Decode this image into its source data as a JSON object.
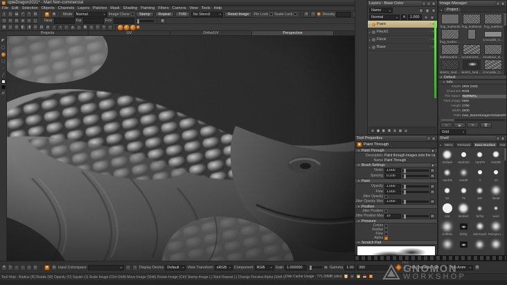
{
  "window": {
    "title": "opieDragon2021* - Mari Non-commercial"
  },
  "menubar": {
    "items": [
      "File",
      "Edit",
      "Selection",
      "Objects",
      "Channels",
      "Layers",
      "Patches",
      "Mask",
      "Shading",
      "Painting",
      "Filters",
      "Camera",
      "View",
      "Tools",
      "Help"
    ]
  },
  "toolbar": {
    "file_icons": [
      {
        "name": "new-project-icon",
        "glyph": "▯"
      },
      {
        "name": "open-project-icon",
        "glyph": "◱"
      },
      {
        "name": "save-project-icon",
        "glyph": "⬓"
      },
      {
        "name": "import-icon",
        "glyph": "↶"
      },
      {
        "name": "export-icon",
        "glyph": "↷"
      },
      {
        "name": "archive-icon",
        "glyph": "▤"
      }
    ],
    "mode_label": "Mode",
    "mode_value": "Normal",
    "image_clone_label": "Image Clone",
    "stamp_label": "Stamp",
    "repeat_label": "Repeat",
    "tvr_label": "TVR",
    "stencil_value": "No Stencil",
    "reset_image_label": "Reset Image",
    "pin_lock_label": "Pin Lock",
    "scale_lock_label": "Scale Lock",
    "density_label": "Density",
    "near_label": "Near",
    "far_label": "Far",
    "fov_label": "FoV",
    "row2_icons": [
      {
        "name": "camera-icon",
        "glyph": "⊡"
      },
      {
        "name": "projector-icon",
        "glyph": "⊟"
      },
      {
        "name": "snapshot-icon",
        "glyph": "⊞"
      },
      {
        "name": "mirror-icon",
        "glyph": "◈"
      },
      {
        "name": "focus-icon",
        "glyph": "⊙"
      },
      {
        "name": "frame-icon",
        "glyph": "◻"
      }
    ],
    "row3_icons": [
      {
        "name": "wireframe-icon",
        "glyph": "▦"
      },
      {
        "name": "shadow-icon",
        "glyph": "◫"
      },
      {
        "name": "grid-icon",
        "glyph": "⊞"
      },
      {
        "name": "mask-view-icon",
        "glyph": "◧"
      },
      {
        "name": "paint-target-icon",
        "glyph": "◨"
      },
      {
        "name": "channels-view-icon",
        "glyph": "☰"
      },
      {
        "name": "layers-view-icon",
        "glyph": "▤"
      },
      {
        "name": "symmetry-icon",
        "glyph": "◍"
      },
      {
        "name": "quarter-icon",
        "glyph": "◔"
      },
      {
        "name": "half-icon",
        "glyph": "◑"
      },
      {
        "name": "play-icon",
        "glyph": "▷"
      },
      {
        "name": "pyramid-icon",
        "glyph": "◭"
      },
      {
        "name": "triangle-icon",
        "glyph": "△"
      },
      {
        "name": "screenshot-icon",
        "glyph": "▣"
      },
      {
        "name": "target-icon",
        "glyph": "◎"
      },
      {
        "name": "hatch-icon",
        "glyph": "☷"
      },
      {
        "name": "uv-grid-icon",
        "glyph": "⌗"
      },
      {
        "name": "star-icon",
        "glyph": "✧"
      }
    ]
  },
  "canvas": {
    "tabs": [
      {
        "label": "Projects",
        "active": false
      },
      {
        "label": "UV",
        "active": false
      },
      {
        "label": "Ortho/UV",
        "active": false
      },
      {
        "label": "Perspective",
        "active": true
      }
    ]
  },
  "layers_panel": {
    "title": "Layers - Base Color",
    "filter_value": "Name",
    "blend_mode": "Normal",
    "count": "4",
    "opacity": "1.000",
    "layers": [
      {
        "name": "Paint",
        "selected": true
      },
      {
        "name": "Fleck1",
        "selected": false
      },
      {
        "name": "Fleck",
        "selected": false
      },
      {
        "name": "Base",
        "selected": false
      }
    ]
  },
  "image_manager": {
    "title": "Image Manager",
    "tab": "Project",
    "thumbnails": [
      {
        "caption": "frog_leathersk",
        "type": "plain"
      },
      {
        "caption": "frog_leathersk",
        "type": "noise"
      },
      {
        "caption": "frog_leathers",
        "type": "noise"
      },
      {
        "caption": "frog_leatherskin.tif",
        "type": "noise"
      },
      {
        "caption": "",
        "type": "tall"
      },
      {
        "caption": "Crocodile_Cayl",
        "type": "wide"
      },
      {
        "caption": "leatherySkin02",
        "type": "noise"
      },
      {
        "caption": "AcneScar01_N",
        "type": "coarse"
      },
      {
        "caption": "Alcastear_Dese",
        "type": "noise"
      },
      {
        "caption": "skin01_Nodule",
        "type": "dark"
      },
      {
        "caption": "skin01_Nodule",
        "type": "shape"
      },
      {
        "caption": "Crocodile_Cayl",
        "type": "coarse"
      }
    ],
    "info_group": "Default",
    "info_sub": "Info",
    "props": [
      {
        "label": "Depth",
        "value": "16bit (half)",
        "hl": false
      },
      {
        "label": "Channels",
        "value": "RGB",
        "hl": false
      },
      {
        "label": "File Space",
        "value": "NORMAL",
        "hl": true
      },
      {
        "label": "Tiled Image",
        "value": "false",
        "hl": false
      },
      {
        "label": "Height",
        "value": "1790",
        "hl": false
      },
      {
        "label": "Width",
        "value": "2000",
        "hl": false
      },
      {
        "label": "Path",
        "value": "mari_BackStorage/AtGates/Fro",
        "hl": false
      }
    ],
    "grid_value": "Grid"
  },
  "tool_properties": {
    "title": "Tool Properties",
    "tool_name": "Paint Through",
    "section_tool": "Paint Through",
    "description_label": "Description",
    "description_value": "Paint through images onto the canvas",
    "name_label": "Name",
    "name_value": "Paint Through",
    "section_brush": "Brush Settings",
    "brush_rows": [
      {
        "label": "Noise",
        "value": "1.000"
      },
      {
        "label": "Spacing",
        "value": "0.100"
      }
    ],
    "section_paint": "Paint",
    "paint_rows": [
      {
        "label": "Opacity",
        "value": "1.000"
      },
      {
        "label": "Flow",
        "value": "1.000"
      }
    ],
    "jitter_opacity_label": "Jitter Opacity",
    "jitter_opacity_max": {
      "label": "Jitter Opacity Max",
      "value": "1.000"
    },
    "section_position": "Position",
    "jitter_position_label": "Jitter Position",
    "jitter_position_max": {
      "label": "Jitter Position Max",
      "value": "10"
    },
    "section_pressure": "Pressure",
    "pressure_checks": [
      {
        "label": "Colors",
        "checked": false
      },
      {
        "label": "Radius",
        "checked": false
      },
      {
        "label": "Flow",
        "checked": false
      },
      {
        "label": "Alpha",
        "checked": true
      }
    ],
    "section_scratch": "Scratch Pad",
    "reset_label": "R"
  },
  "shelf": {
    "title": "Shelf",
    "tabs": [
      {
        "label": "Menu",
        "active": false
      },
      {
        "label": "Personal",
        "active": false
      },
      {
        "label": "Basic Brushes",
        "active": true
      },
      {
        "label": "Har",
        "active": false
      }
    ],
    "brushes": [
      {
        "name": "Default",
        "s": 11,
        "b": 1.2
      },
      {
        "name": "Hard100",
        "s": 7,
        "b": 0
      },
      {
        "name": "Hard75",
        "s": 7,
        "b": 0.4
      },
      {
        "name": "Hard50",
        "s": 8,
        "b": 0.8
      },
      {
        "name": "Hard25",
        "s": 7,
        "b": 1.2
      },
      {
        "name": "Hard0",
        "s": 7,
        "b": 1.8
      },
      {
        "name": "0",
        "s": 6,
        "b": 0
      },
      {
        "name": "10",
        "s": 6,
        "b": 0.3
      },
      {
        "name": "50",
        "s": 7,
        "b": 0.6
      },
      {
        "name": "75",
        "s": 7,
        "b": 0.9
      },
      {
        "name": "100",
        "s": 7,
        "b": 1.2
      },
      {
        "name": "linear",
        "s": 10,
        "b": 2.2
      },
      {
        "name": "one",
        "s": 14,
        "b": 0.2
      },
      {
        "name": "lambert",
        "s": 12,
        "b": 1.6
      },
      {
        "name": "falTip",
        "s": 5,
        "b": 1
      },
      {
        "name": "worn",
        "s": 4,
        "b": 0.8
      },
      {
        "name": "SoftMix",
        "s": 11,
        "b": 2.6
      },
      {
        "name": "falTip",
        "s": 9,
        "b": 0,
        "img": true
      },
      {
        "name": "sideTouch",
        "s": 8,
        "b": 1.6
      },
      {
        "name": "PointyLinear",
        "s": 10,
        "b": 2.4
      },
      {
        "name": "",
        "s": 10,
        "b": 2.6
      },
      {
        "name": "",
        "s": 9,
        "b": 0,
        "img": true
      },
      {
        "name": "",
        "s": 9,
        "b": 2
      },
      {
        "name": "",
        "s": 10,
        "b": 2.4
      }
    ]
  },
  "bottom_bar": {
    "transform_icons": [
      {
        "name": "move-image-icon",
        "glyph": "✚"
      },
      {
        "name": "rotate-image-icon",
        "glyph": "↻"
      },
      {
        "name": "drop-icon",
        "glyph": "↓"
      },
      {
        "name": "radius-icon",
        "glyph": "○"
      },
      {
        "name": "squish-icon",
        "glyph": "◇"
      },
      {
        "name": "opacity-icon",
        "glyph": "◎"
      }
    ],
    "input_colorspace_label": "Input Colorspace",
    "display_device_label": "Display Device",
    "display_device_value": "Default",
    "view_transform_label": "View Transform",
    "view_transform_value": "sRGB",
    "component_label": "Component",
    "component_value": "RGB",
    "gain_label": "Gain",
    "gain_value": "1.000000",
    "gamma_label": "Gamma",
    "gamma_value": "1.00",
    "reset_label": "R"
  },
  "timeline": {
    "frame": "300",
    "character_set": "No Character Set",
    "anim": "No Anim"
  },
  "status_bar": {
    "help": "Tool Help :   Radius (R)   Rotate (W)   Opacity (O)   Squish (J)   Scale Image (Ctrl+Shift)   Move Image (Shift)   Rotate Image (Ctrl)   Stamp Image (.)   Start Repeat (,)   Change Preview Alpha (Shift /)",
    "disk_cache": "Disk Cache Usage : 771.99MB (slim)"
  },
  "watermark": {
    "the": "the",
    "line1": "GNOMON",
    "line2": "WORKSHOP"
  },
  "colors": {
    "accent": "#e8821e",
    "green_bar": "#43d62c",
    "selected_layer": "#c9b98f"
  }
}
